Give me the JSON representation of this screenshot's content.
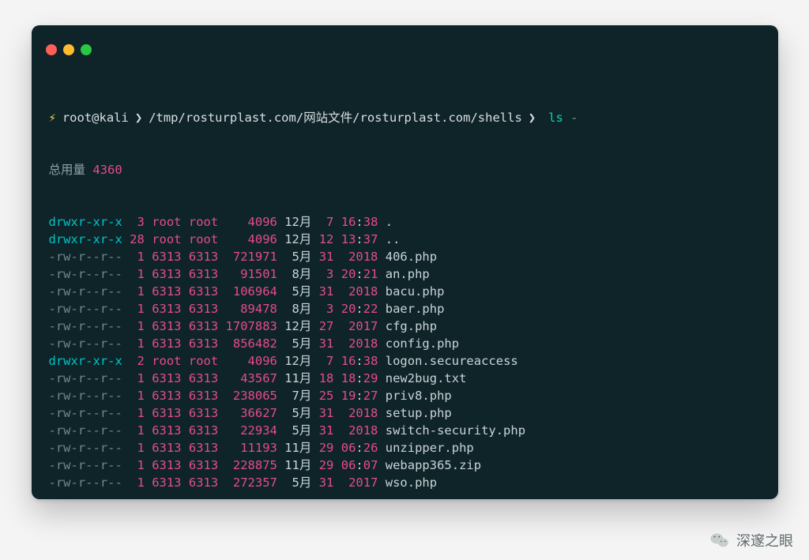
{
  "window": {
    "buttons": {
      "close": "#ff5f57",
      "min": "#febc2e",
      "max": "#28c840"
    }
  },
  "prompt": {
    "bolt": "⚡",
    "user": "root@kali",
    "chevron": "❯",
    "path": "/tmp/rosturplast.com/网站文件/rosturplast.com/shells",
    "command": "ls",
    "flags": " -"
  },
  "total": {
    "label": "总用量 ",
    "value": "4360"
  },
  "listing": [
    {
      "perm": "drwxr-xr-x",
      "dir": true,
      "links": "3",
      "owner": "root",
      "group": "root",
      "size": "4096",
      "month": "12月",
      "day": "7",
      "time_year": "16:38",
      "name": "."
    },
    {
      "perm": "drwxr-xr-x",
      "dir": true,
      "links": "28",
      "owner": "root",
      "group": "root",
      "size": "4096",
      "month": "12月",
      "day": "12",
      "time_year": "13:37",
      "name": ".."
    },
    {
      "perm": "-rw-r--r--",
      "dir": false,
      "links": "1",
      "owner": "6313",
      "group": "6313",
      "size": "721971",
      "month": "5月",
      "day": "31",
      "time_year": "2018",
      "name": "406.php"
    },
    {
      "perm": "-rw-r--r--",
      "dir": false,
      "links": "1",
      "owner": "6313",
      "group": "6313",
      "size": "91501",
      "month": "8月",
      "day": "3",
      "time_year": "20:21",
      "name": "an.php"
    },
    {
      "perm": "-rw-r--r--",
      "dir": false,
      "links": "1",
      "owner": "6313",
      "group": "6313",
      "size": "106964",
      "month": "5月",
      "day": "31",
      "time_year": "2018",
      "name": "bacu.php"
    },
    {
      "perm": "-rw-r--r--",
      "dir": false,
      "links": "1",
      "owner": "6313",
      "group": "6313",
      "size": "89478",
      "month": "8月",
      "day": "3",
      "time_year": "20:22",
      "name": "baer.php"
    },
    {
      "perm": "-rw-r--r--",
      "dir": false,
      "links": "1",
      "owner": "6313",
      "group": "6313",
      "size": "1707883",
      "month": "12月",
      "day": "27",
      "time_year": "2017",
      "name": "cfg.php"
    },
    {
      "perm": "-rw-r--r--",
      "dir": false,
      "links": "1",
      "owner": "6313",
      "group": "6313",
      "size": "856482",
      "month": "5月",
      "day": "31",
      "time_year": "2018",
      "name": "config.php"
    },
    {
      "perm": "drwxr-xr-x",
      "dir": true,
      "links": "2",
      "owner": "root",
      "group": "root",
      "size": "4096",
      "month": "12月",
      "day": "7",
      "time_year": "16:38",
      "name": "logon.secureaccess"
    },
    {
      "perm": "-rw-r--r--",
      "dir": false,
      "links": "1",
      "owner": "6313",
      "group": "6313",
      "size": "43567",
      "month": "11月",
      "day": "18",
      "time_year": "18:29",
      "name": "new2bug.txt"
    },
    {
      "perm": "-rw-r--r--",
      "dir": false,
      "links": "1",
      "owner": "6313",
      "group": "6313",
      "size": "238065",
      "month": "7月",
      "day": "25",
      "time_year": "19:27",
      "name": "priv8.php"
    },
    {
      "perm": "-rw-r--r--",
      "dir": false,
      "links": "1",
      "owner": "6313",
      "group": "6313",
      "size": "36627",
      "month": "5月",
      "day": "31",
      "time_year": "2018",
      "name": "setup.php"
    },
    {
      "perm": "-rw-r--r--",
      "dir": false,
      "links": "1",
      "owner": "6313",
      "group": "6313",
      "size": "22934",
      "month": "5月",
      "day": "31",
      "time_year": "2018",
      "name": "switch-security.php"
    },
    {
      "perm": "-rw-r--r--",
      "dir": false,
      "links": "1",
      "owner": "6313",
      "group": "6313",
      "size": "11193",
      "month": "11月",
      "day": "29",
      "time_year": "06:26",
      "name": "unzipper.php"
    },
    {
      "perm": "-rw-r--r--",
      "dir": false,
      "links": "1",
      "owner": "6313",
      "group": "6313",
      "size": "228875",
      "month": "11月",
      "day": "29",
      "time_year": "06:07",
      "name": "webapp365.zip"
    },
    {
      "perm": "-rw-r--r--",
      "dir": false,
      "links": "1",
      "owner": "6313",
      "group": "6313",
      "size": "272357",
      "month": "5月",
      "day": "31",
      "time_year": "2017",
      "name": "wso.php"
    }
  ],
  "watermark": {
    "text": "深邃之眼"
  }
}
